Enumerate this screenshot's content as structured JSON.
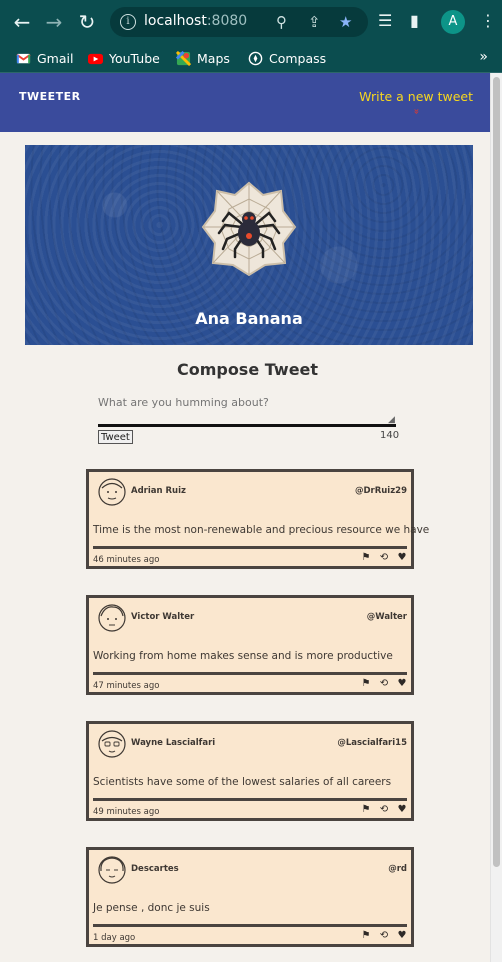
{
  "browser": {
    "url_host": "localhost",
    "url_port": ":8080",
    "profile_initial": "A",
    "bookmarks": [
      {
        "label": "Gmail",
        "icon": "gmail-icon"
      },
      {
        "label": "YouTube",
        "icon": "youtube-icon"
      },
      {
        "label": "Maps",
        "icon": "maps-icon"
      },
      {
        "label": "Compass",
        "icon": "compass-icon"
      }
    ],
    "more_bookmarks": "»"
  },
  "header": {
    "logo": "TWEETER",
    "write_link": "Write a new tweet",
    "write_arrow": "»"
  },
  "profile": {
    "name": "Ana Banana"
  },
  "compose": {
    "title": "Compose Tweet",
    "placeholder": "What are you humming about?",
    "button": "Tweet",
    "counter": "140"
  },
  "tweets": [
    {
      "name": "Adrian Ruiz",
      "handle": "@DrRuiz29",
      "text": "Time is the most non-renewable and precious resource we have",
      "time": "46 minutes ago"
    },
    {
      "name": "Victor Walter",
      "handle": "@Walter",
      "text": "Working from home makes sense and is more productive",
      "time": "47 minutes ago"
    },
    {
      "name": "Wayne Lascialfari",
      "handle": "@Lascialfari15",
      "text": "Scientists have some of the lowest salaries of all careers",
      "time": "49 minutes ago"
    },
    {
      "name": "Descartes",
      "handle": "@rd",
      "text": "Je pense , donc je suis",
      "time": "1 day ago"
    }
  ],
  "colors": {
    "chrome": "#0b4d4f",
    "header": "#3a4b9c",
    "write_link": "#f7d71f",
    "tweet_bg": "#fae7cf",
    "tweet_border": "#4a4440"
  }
}
